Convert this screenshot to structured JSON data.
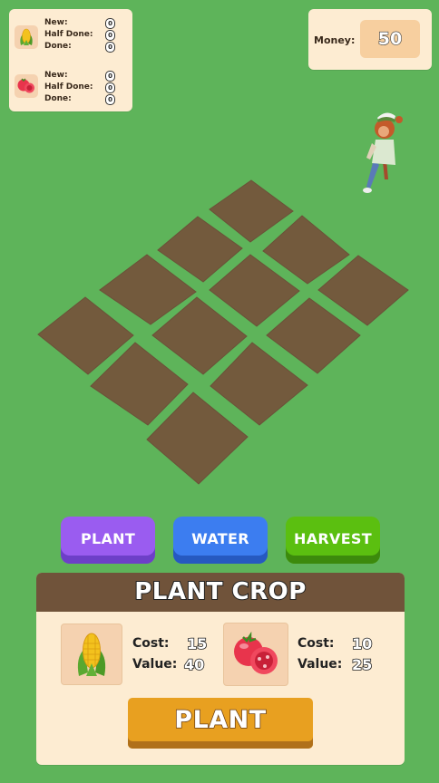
{
  "stats": {
    "crops": [
      {
        "icon": "corn-icon",
        "rows": [
          {
            "label": "New:",
            "value": "0"
          },
          {
            "label": "Half Done:",
            "value": "0"
          },
          {
            "label": "Done:",
            "value": "0"
          }
        ]
      },
      {
        "icon": "tomato-icon",
        "rows": [
          {
            "label": "New:",
            "value": "0"
          },
          {
            "label": "Half Done:",
            "value": "0"
          },
          {
            "label": "Done:",
            "value": "0"
          }
        ]
      }
    ]
  },
  "money": {
    "label": "Money:",
    "value": "50"
  },
  "actions": {
    "plant": "PLANT",
    "water": "WATER",
    "harvest": "HARVEST"
  },
  "plant_panel": {
    "title": "PLANT CROP",
    "crops": [
      {
        "icon": "corn-icon",
        "cost_label": "Cost:",
        "cost": "15",
        "value_label": "Value:",
        "value": "40"
      },
      {
        "icon": "tomato-icon",
        "cost_label": "Cost:",
        "cost": "10",
        "value_label": "Value:",
        "value": "25"
      }
    ],
    "confirm_label": "PLANT"
  },
  "colors": {
    "grass": "#5eb45a",
    "soil": "#735a3d",
    "panel": "#fdecd2",
    "plant_button": "#9a5cf0",
    "water_button": "#3c7df0",
    "harvest_button": "#5bbf10",
    "confirm_button": "#e8a020"
  },
  "field": {
    "plot_count": 13
  }
}
